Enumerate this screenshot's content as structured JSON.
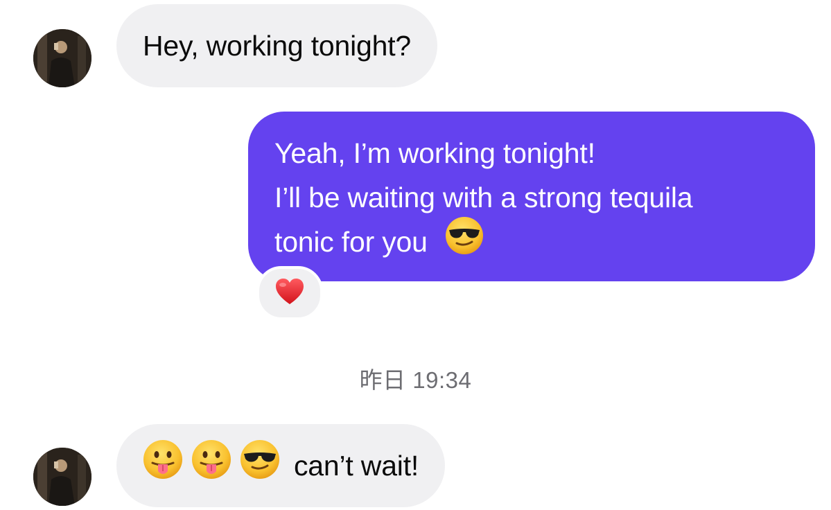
{
  "messages": [
    {
      "direction": "incoming",
      "text": "Hey, working tonight?"
    },
    {
      "direction": "outgoing",
      "lines": [
        "Yeah, I’m working tonight!",
        "I’ll be waiting with a strong tequila",
        "tonic for you"
      ],
      "trailing_emoji": "sunglasses-face",
      "reaction": "red-heart"
    },
    {
      "direction": "incoming",
      "emojis": [
        "tongue-out-face",
        "tongue-out-face",
        "sunglasses-face"
      ],
      "text": "can’t wait!"
    }
  ],
  "timestamp": "昨日 19:34",
  "colors": {
    "outgoing_bubble": "#6442ef",
    "incoming_bubble": "#f0f0f2",
    "timestamp_text": "#6d6d72"
  }
}
